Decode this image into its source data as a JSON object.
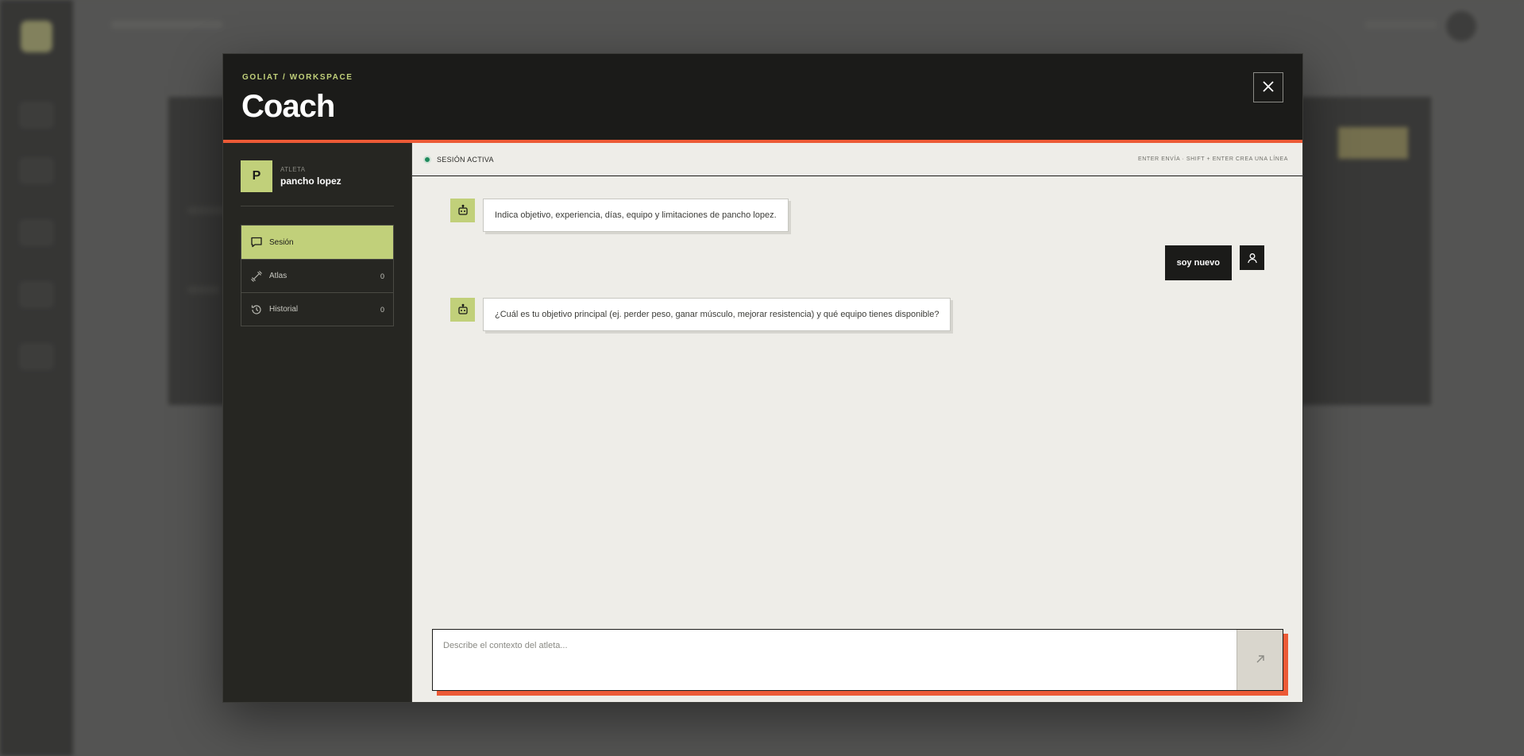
{
  "modal": {
    "breadcrumb": "GOLIAT / WORKSPACE",
    "title": "Coach"
  },
  "athlete": {
    "initial": "P",
    "role": "ATLETA",
    "name": "pancho lopez"
  },
  "nav": [
    {
      "label": "Sesión",
      "icon": "chat-bubble-icon",
      "count": "",
      "active": true
    },
    {
      "label": "Atlas",
      "icon": "dumbbell-icon",
      "count": "0",
      "active": false
    },
    {
      "label": "Historial",
      "icon": "history-icon",
      "count": "0",
      "active": false
    }
  ],
  "chat": {
    "status": "SESIÓN ACTIVA",
    "hint": "ENTER ENVÍA · SHIFT + ENTER CREA UNA LÍNEA",
    "messages": [
      {
        "role": "bot",
        "text": "Indica objetivo, experiencia, días, equipo y limitaciones de pancho lopez."
      },
      {
        "role": "user",
        "text": "soy nuevo"
      },
      {
        "role": "bot",
        "text": "¿Cuál es tu objetivo principal (ej. perder peso, ganar músculo, mejorar resistencia) y qué equipo tienes disponible?"
      }
    ],
    "composer_placeholder": "Describe el contexto del atleta..."
  },
  "colors": {
    "accent": "#c1d07a",
    "brand_orange": "#ec5a36",
    "dark": "#1b1b19",
    "status_green": "#1f8a5c"
  }
}
